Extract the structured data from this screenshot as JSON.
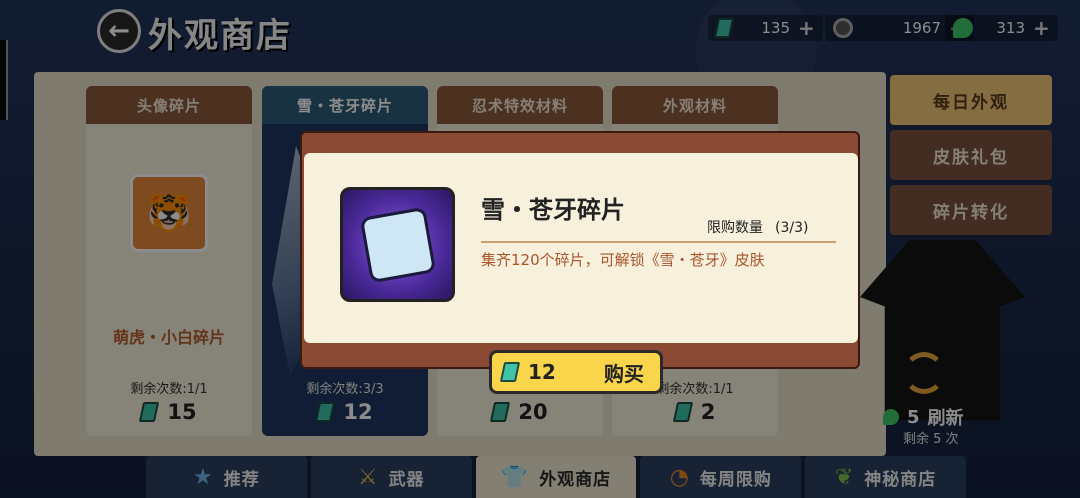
{
  "header": {
    "back_icon": "arrow-left-icon",
    "title": "外观商店",
    "currencies": [
      {
        "icon": "ticket-icon",
        "value": "135"
      },
      {
        "icon": "coin-icon",
        "value": "1967"
      },
      {
        "icon": "gem-icon",
        "value": "313"
      }
    ]
  },
  "cards": [
    {
      "tab": "头像碎片",
      "name": "萌虎・小白碎片",
      "remain": "剩余次数:1/1",
      "price": "15"
    },
    {
      "tab": "雪・苍牙碎片",
      "name": "",
      "remain": "剩余次数:3/3",
      "price": "12"
    },
    {
      "tab": "忍术特效材料",
      "name": "",
      "remain": "",
      "price": "20"
    },
    {
      "tab": "外观材料",
      "name": "",
      "remain": "剩余次数:1/1",
      "price": "2"
    }
  ],
  "side_tabs": [
    "每日外观",
    "皮肤礼包",
    "碎片转化"
  ],
  "refresh": {
    "cost": "5",
    "label": "刷新",
    "remaining": "剩余 5 次"
  },
  "bottom_nav": [
    {
      "label": "推荐",
      "icon": "star-icon"
    },
    {
      "label": "武器",
      "icon": "sword-icon"
    },
    {
      "label": "外观商店",
      "icon": "shirt-icon"
    },
    {
      "label": "每周限购",
      "icon": "clock-icon"
    },
    {
      "label": "神秘商店",
      "icon": "leaf-icon"
    }
  ],
  "modal": {
    "title": "雪・苍牙碎片",
    "limit_label": "限购数量",
    "limit_value": "(3/3)",
    "description": "集齐120个碎片，可解锁《雪・苍牙》皮肤",
    "price": "12",
    "buy_label": "购买"
  }
}
